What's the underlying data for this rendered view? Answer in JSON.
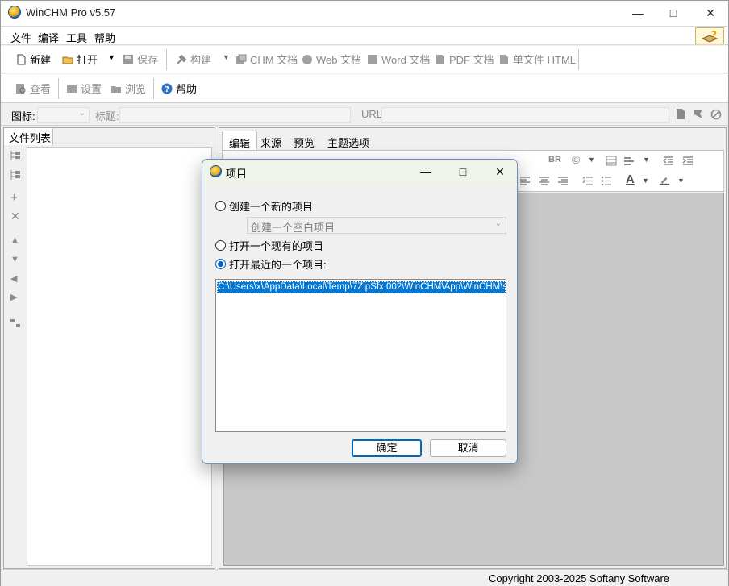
{
  "window": {
    "title": "WinCHM Pro v5.57"
  },
  "menu": [
    "文件",
    "编译",
    "工具",
    "帮助"
  ],
  "toolbar1": {
    "new": "新建",
    "open": "打开",
    "save": "保存",
    "build": "构建",
    "chm": "CHM 文档",
    "web": "Web 文档",
    "word": "Word 文档",
    "pdf": "PDF 文档",
    "single_html": "单文件 HTML"
  },
  "toolbar2": {
    "view": "查看",
    "settings": "设置",
    "browse": "浏览",
    "help": "帮助"
  },
  "propbar": {
    "icon_label": "图标:",
    "title_label": "标题:",
    "url_label": "URL:"
  },
  "left_panel": {
    "tab": "文件列表"
  },
  "editor_tabs": [
    "编辑",
    "来源",
    "预览",
    "主题选项"
  ],
  "editor_toolbar": {
    "br": "BR"
  },
  "status": {
    "copyright": "Copyright 2003-2025 Softany Software"
  },
  "dialog": {
    "title": "项目",
    "option_new": "创建一个新的项目",
    "template_selected": "创建一个空白项目",
    "option_open": "打开一个现有的项目",
    "option_recent": "打开最近的一个项目:",
    "recent_items": [
      "C:\\Users\\x\\AppData\\Local\\Temp\\7ZipSfx.002\\WinCHM\\App\\WinCHM\\s"
    ],
    "ok": "确定",
    "cancel": "取消"
  },
  "colors": {
    "accent": "#0078d7",
    "dialog_title_bg": "#eef4ea"
  }
}
